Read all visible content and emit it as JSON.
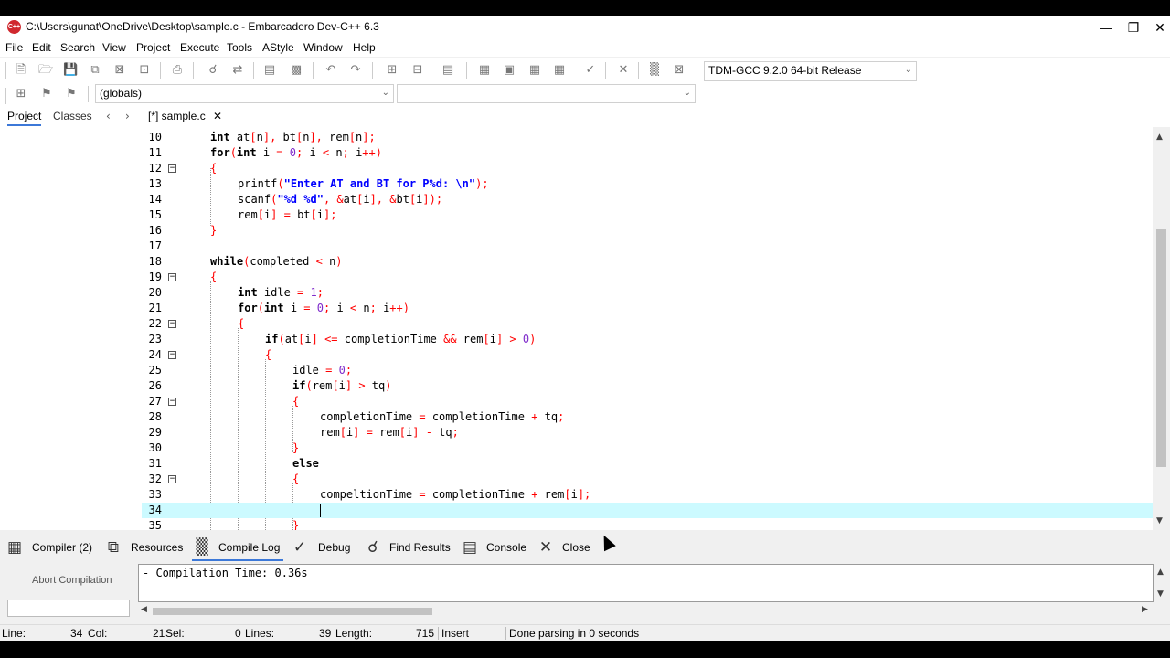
{
  "window": {
    "title": "C:\\Users\\gunat\\OneDrive\\Desktop\\sample.c - Embarcadero Dev-C++ 6.3",
    "icon_text": "C++"
  },
  "menu": [
    "File",
    "Edit",
    "Search",
    "View",
    "Project",
    "Execute",
    "Tools",
    "AStyle",
    "Window",
    "Help"
  ],
  "toolbar": {
    "compiler_select": "TDM-GCC 9.2.0 64-bit Release",
    "scope_select": "(globals)",
    "member_select": ""
  },
  "tabs": {
    "project": "Project",
    "classes": "Classes",
    "file_tab": "[*] sample.c"
  },
  "editor": {
    "current_line": 34,
    "lines": [
      {
        "n": "10",
        "code": "int at[n], bt[n], rem[n];"
      },
      {
        "n": "11",
        "code": "for(int i = 0; i < n; i++)"
      },
      {
        "n": "12",
        "code": "{"
      },
      {
        "n": "13",
        "code": "printf(\"Enter AT and BT for P%d: \\n\");"
      },
      {
        "n": "14",
        "code": "scanf(\"%d %d\", &at[i], &bt[i]);"
      },
      {
        "n": "15",
        "code": "rem[i] = bt[i];"
      },
      {
        "n": "16",
        "code": "}"
      },
      {
        "n": "17",
        "code": ""
      },
      {
        "n": "18",
        "code": "while(completed < n)"
      },
      {
        "n": "19",
        "code": "{"
      },
      {
        "n": "20",
        "code": "int idle = 1;"
      },
      {
        "n": "21",
        "code": "for(int i = 0; i < n; i++)"
      },
      {
        "n": "22",
        "code": "{"
      },
      {
        "n": "23",
        "code": "if(at[i] <= completionTime && rem[i] > 0)"
      },
      {
        "n": "24",
        "code": "{"
      },
      {
        "n": "25",
        "code": "idle = 0;"
      },
      {
        "n": "26",
        "code": "if(rem[i] > tq)"
      },
      {
        "n": "27",
        "code": "{"
      },
      {
        "n": "28",
        "code": "completionTime = completionTime + tq;"
      },
      {
        "n": "29",
        "code": "rem[i] = rem[i] - tq;"
      },
      {
        "n": "30",
        "code": "}"
      },
      {
        "n": "31",
        "code": "else"
      },
      {
        "n": "32",
        "code": "{"
      },
      {
        "n": "33",
        "code": "compeltionTime = completionTime + rem[i];"
      },
      {
        "n": "34",
        "code": ""
      },
      {
        "n": "35",
        "code": "}"
      }
    ]
  },
  "bottom_tabs": {
    "compiler": "Compiler (2)",
    "resources": "Resources",
    "compile_log": "Compile Log",
    "debug": "Debug",
    "find_results": "Find Results",
    "console": "Console",
    "close": "Close"
  },
  "compile": {
    "abort_label": "Abort Compilation",
    "log": "- Compilation Time: 0.36s"
  },
  "status": {
    "line_label": "Line:",
    "line_value": "34",
    "col_label": "Col:",
    "col_value": "21",
    "sel_label": "Sel:",
    "sel_value": "0",
    "lines_label": "Lines:",
    "lines_value": "39",
    "length_label": "Length:",
    "length_value": "715",
    "mode": "Insert",
    "message": "Done parsing in 0 seconds"
  }
}
